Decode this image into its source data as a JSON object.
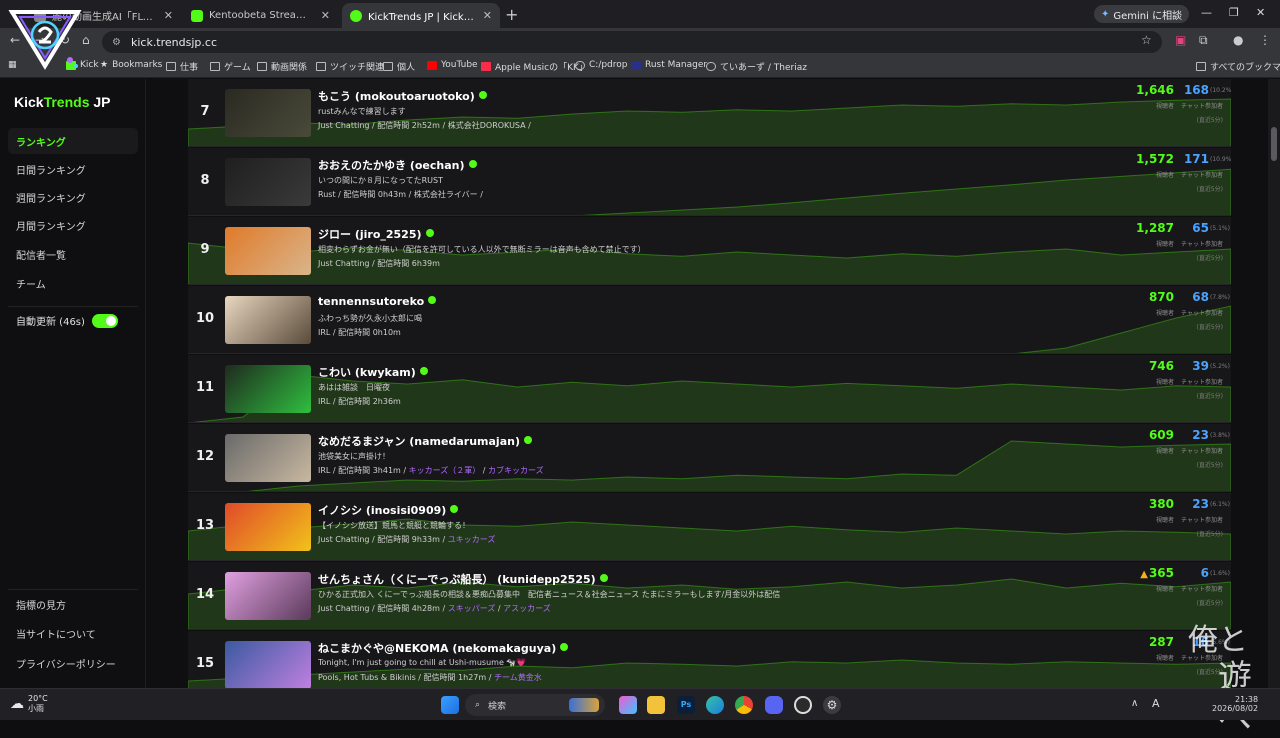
{
  "browser": {
    "tabs": [
      {
        "title": "麗の動画生成AI「FLUX 3」は文",
        "active": false
      },
      {
        "title": "Kentoobeta Stream - Watch Liv",
        "active": false
      },
      {
        "title": "KickTrends JP | Kick日本配信者",
        "active": true
      }
    ],
    "gemini_label": "Gemini に相談",
    "url": "kick.trendsjp.cc",
    "bookmarks": [
      "Kick",
      "Bookmarks",
      "仕事",
      "ゲーム",
      "動画関係",
      "ツイッチ関連",
      "個人",
      "YouTube",
      "Apple Musicの「KK」",
      "C:/pdrop",
      "Rust Manager",
      "ていあーず / Theriaz"
    ],
    "all_bookmarks": "すべてのブックマーク"
  },
  "sidebar": {
    "brand": {
      "part1": "Kick",
      "part2": "Trends",
      "part3": " JP"
    },
    "nav": [
      "ランキング",
      "日間ランキング",
      "週間ランキング",
      "月間ランキング",
      "配信者一覧",
      "チーム"
    ],
    "auto_refresh": "自動更新 (46s)",
    "footer": [
      "指標の見方",
      "当サイトについて",
      "プライバシーポリシー"
    ]
  },
  "labels": {
    "viewers": "視聴者",
    "chat": "チャット参加者",
    "avg": "(直近5分)"
  },
  "streams": [
    {
      "rank": "7",
      "name": "もこう (mokoutoaruotoko)",
      "desc": "rustみんなで練習します",
      "category": "Just Chatting",
      "duration": "配信時間 2h52m",
      "tags": [],
      "extra": "株式会社DOROKUSA /",
      "viewers": "1,646",
      "chat": "168",
      "pct": "(10.2%)",
      "warn": false,
      "trend": [
        0.3,
        0.35,
        0.4,
        0.38,
        0.45,
        0.5,
        0.48,
        0.55,
        0.6,
        0.58,
        0.62,
        0.6,
        0.65,
        0.7,
        0.68,
        0.72,
        0.7,
        0.75,
        0.78,
        0.8
      ]
    },
    {
      "rank": "8",
      "name": "おおえのたかゆき (oechan)",
      "desc": "いつの間にか８月になってたRUST",
      "category": "Rust",
      "duration": "配信時間 0h43m",
      "tags": [],
      "extra": "株式会社ライバー /",
      "viewers": "1,572",
      "chat": "171",
      "pct": "(10.9%)",
      "warn": false,
      "trend": [
        0,
        0,
        0,
        0,
        0,
        0,
        0,
        0,
        0.05,
        0.1,
        0.15,
        0.22,
        0.3,
        0.38,
        0.45,
        0.52,
        0.6,
        0.66,
        0.72,
        0.78
      ]
    },
    {
      "rank": "9",
      "name": "ジロー (jiro_2525)",
      "desc": "相変わらずお金が無い（配信を許可している人以外で無断ミラーは音声も含めて禁止です）",
      "category": "Just Chatting",
      "duration": "配信時間 6h39m",
      "tags": [],
      "extra": "",
      "viewers": "1,287",
      "chat": "65",
      "pct": "(5.1%)",
      "warn": false,
      "trend": [
        0.7,
        0.6,
        0.55,
        0.62,
        0.58,
        0.5,
        0.55,
        0.6,
        0.52,
        0.48,
        0.55,
        0.5,
        0.45,
        0.52,
        0.48,
        0.55,
        0.6,
        0.5,
        0.55,
        0.6
      ]
    },
    {
      "rank": "10",
      "name": "tennennsutoreko",
      "desc": "ふわっち勢が久永小太郎に喝",
      "category": "IRL",
      "duration": "配信時間 0h10m",
      "tags": [],
      "extra": "",
      "viewers": "870",
      "chat": "68",
      "pct": "(7.8%)",
      "warn": false,
      "trend": [
        0,
        0,
        0,
        0,
        0,
        0,
        0,
        0,
        0,
        0,
        0,
        0,
        0,
        0,
        0,
        0,
        0.1,
        0.35,
        0.6,
        0.8
      ]
    },
    {
      "rank": "11",
      "name": "こわい (kwykam)",
      "desc": "あはは雑談　日曜夜",
      "category": "IRL",
      "duration": "配信時間 2h36m",
      "tags": [],
      "extra": "",
      "viewers": "746",
      "chat": "39",
      "pct": "(5.2%)",
      "warn": false,
      "trend": [
        0,
        0.1,
        0.8,
        0.7,
        0.65,
        0.72,
        0.6,
        0.68,
        0.62,
        0.7,
        0.65,
        0.6,
        0.66,
        0.62,
        0.58,
        0.65,
        0.6,
        0.55,
        0.62,
        0.6
      ]
    },
    {
      "rank": "12",
      "name": "なめだるまジャン (namedarumajan)",
      "desc": "池袋美女に声掛け！",
      "category": "IRL",
      "duration": "配信時間 3h41m",
      "tags": [
        "キッカーズ（２軍）",
        "カブキッカーズ"
      ],
      "extra": "",
      "viewers": "609",
      "chat": "23",
      "pct": "(3.8%)",
      "warn": false,
      "trend": [
        0,
        0,
        0.1,
        0.15,
        0.2,
        0.18,
        0.22,
        0.2,
        0.25,
        0.22,
        0.28,
        0.25,
        0.22,
        0.3,
        0.28,
        0.85,
        0.8,
        0.75,
        0.78,
        0.8
      ]
    },
    {
      "rank": "13",
      "name": "イノシシ (inosisi0909)",
      "desc": "【イノシシ放送】競馬と競艇と競輪する！",
      "category": "Just Chatting",
      "duration": "配信時間 9h33m",
      "tags": [
        "ユキッカーズ"
      ],
      "extra": "",
      "viewers": "380",
      "chat": "23",
      "pct": "(6.1%)",
      "warn": false,
      "trend": [
        0.5,
        0.6,
        0.55,
        0.62,
        0.7,
        0.6,
        0.58,
        0.65,
        0.6,
        0.55,
        0.5,
        0.58,
        0.52,
        0.48,
        0.55,
        0.5,
        0.45,
        0.5,
        0.48,
        0.45
      ]
    },
    {
      "rank": "14",
      "name": "せんちょさん（くにーでっぷ船長） (kunidepp2525)",
      "desc": "ひかる正式加入 くにーでっぷ船長の相談＆悪痴凸募集中　配信者ニュース＆社会ニュース たまにミラーもします/月金以外は配信",
      "category": "Just Chatting",
      "duration": "配信時間 4h28m",
      "tags": [
        "スキッパーズ",
        "アスッカーズ"
      ],
      "extra": "",
      "viewers": "365",
      "chat": "6",
      "pct": "(1.6%)",
      "warn": true,
      "trend": [
        0.6,
        0.7,
        0.65,
        0.75,
        0.7,
        0.8,
        0.72,
        0.78,
        0.7,
        0.75,
        0.68,
        0.72,
        0.8,
        0.7,
        0.75,
        0.85,
        0.7,
        0.78,
        0.72,
        0.8
      ]
    },
    {
      "rank": "15",
      "name": "ねこまかぐや@NEKOMA (nekomakaguya)",
      "desc": "Tonight, I'm just going to chill at Ushi-musume 🐄💗",
      "category": "Pools, Hot Tubs & Bikinis",
      "duration": "配信時間 1h27m",
      "tags": [
        "チーム黄金水"
      ],
      "extra": "",
      "viewers": "287",
      "chat": "16",
      "pct": "(5.6%)",
      "warn": false,
      "trend": [
        0.3,
        0.35,
        0.4,
        0.45,
        0.5,
        0.48,
        0.55,
        0.52,
        0.6,
        0.58,
        0.55,
        0.62,
        0.6,
        0.65,
        0.6,
        0.58,
        0.62,
        0.6,
        0.58,
        0.6
      ]
    }
  ],
  "watermark": {
    "line1": "俺と",
    "line2": "遊べ"
  },
  "taskbar": {
    "weather_temp": "20°C",
    "weather_desc": "小雨",
    "search": "検索",
    "time": "21:38",
    "date": "2026/08/02"
  },
  "colors": {
    "kick_green": "#53fc18",
    "chat_blue": "#4aa3ff",
    "tag_purple": "#b06bff"
  }
}
